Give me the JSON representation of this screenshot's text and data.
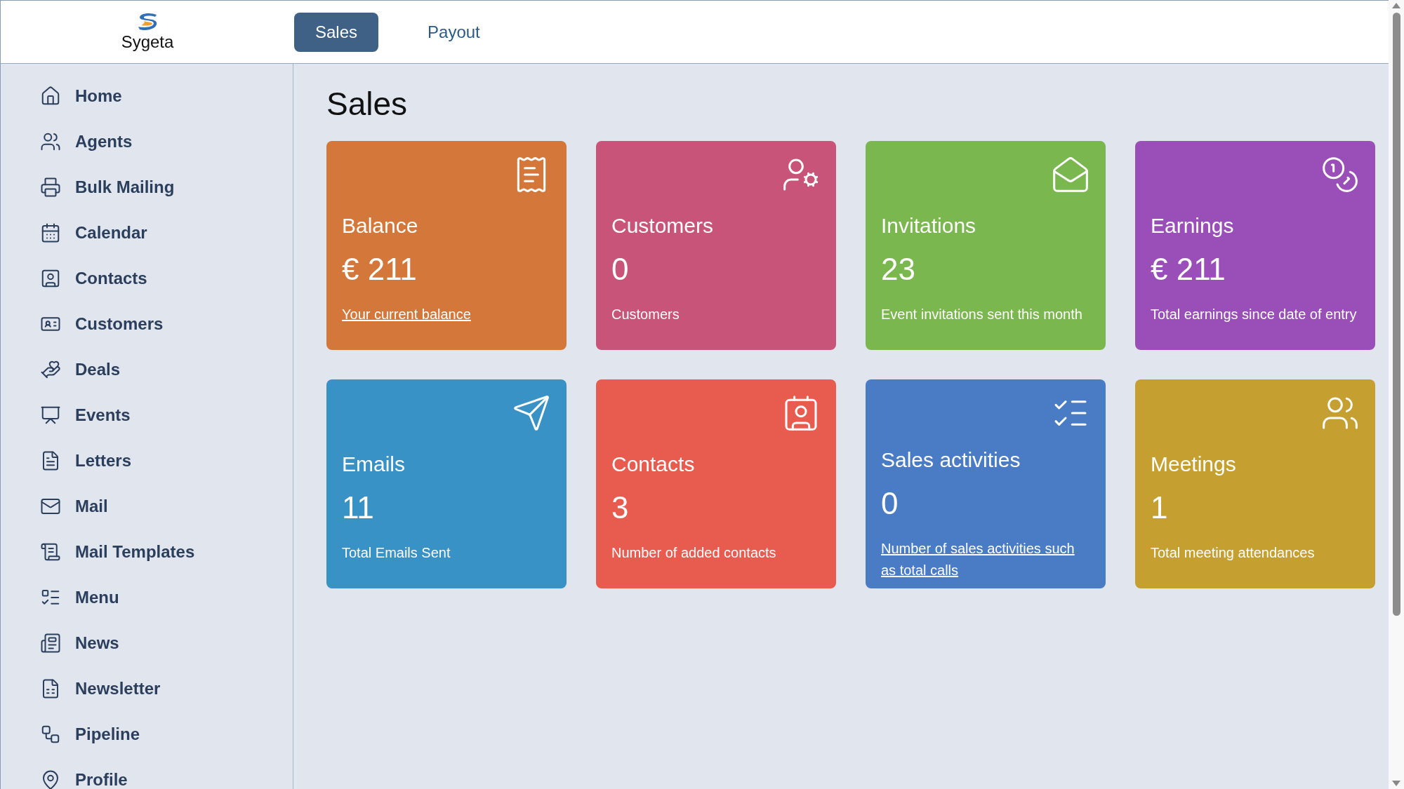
{
  "logo": {
    "name": "Sygeta"
  },
  "tabs": [
    {
      "label": "Sales",
      "selected": true
    },
    {
      "label": "Payout",
      "selected": false
    }
  ],
  "sidebar": {
    "items": [
      {
        "label": "Home"
      },
      {
        "label": "Agents"
      },
      {
        "label": "Bulk Mailing"
      },
      {
        "label": "Calendar"
      },
      {
        "label": "Contacts"
      },
      {
        "label": "Customers"
      },
      {
        "label": "Deals"
      },
      {
        "label": "Events"
      },
      {
        "label": "Letters"
      },
      {
        "label": "Mail"
      },
      {
        "label": "Mail Templates"
      },
      {
        "label": "Menu"
      },
      {
        "label": "News"
      },
      {
        "label": "Newsletter"
      },
      {
        "label": "Pipeline"
      },
      {
        "label": "Profile"
      }
    ]
  },
  "page": {
    "title": "Sales"
  },
  "cards": [
    {
      "title": "Balance",
      "value": "€ 211",
      "description": "Your current balance",
      "link": true,
      "color": "#d4773a"
    },
    {
      "title": "Customers",
      "value": "0",
      "description": "Customers",
      "link": false,
      "color": "#c95479"
    },
    {
      "title": "Invitations",
      "value": "23",
      "description": "Event invitations sent this month",
      "link": false,
      "color": "#7bb74f"
    },
    {
      "title": "Earnings",
      "value": "€ 211",
      "description": "Total earnings since date of entry",
      "link": false,
      "color": "#9a4fb8"
    },
    {
      "title": "Emails",
      "value": "11",
      "description": "Total Emails Sent",
      "link": false,
      "color": "#3892c6"
    },
    {
      "title": "Contacts",
      "value": "3",
      "description": "Number of added contacts",
      "link": false,
      "color": "#e85c50"
    },
    {
      "title": "Sales activities",
      "value": "0",
      "description": "Number of sales activities such as total calls",
      "link": true,
      "color": "#4a7cc6"
    },
    {
      "title": "Meetings",
      "value": "1",
      "description": "Total meeting attendances",
      "link": false,
      "color": "#c5a030"
    }
  ]
}
